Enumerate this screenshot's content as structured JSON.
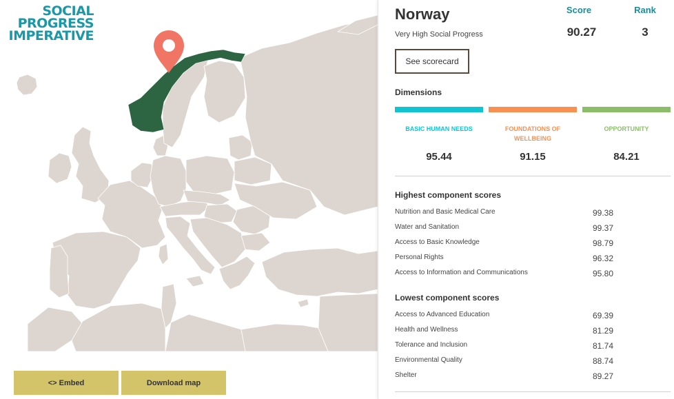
{
  "brand": {
    "logo_lines": [
      "SOCIAL",
      "PROGRESS",
      "IMPERATIVE"
    ],
    "accent_color": "#1a98a8"
  },
  "map": {
    "selected_color": "#2d6442",
    "land_color": "#ddd6d0",
    "marker_color": "#f07565",
    "marker_icon": "location-pin-icon"
  },
  "actions": {
    "embed_label": "<> Embed",
    "download_label": "Download map"
  },
  "panel": {
    "country": "Norway",
    "tier": "Very High Social Progress",
    "score_label": "Score",
    "rank_label": "Rank",
    "score": "90.27",
    "rank": "3",
    "scorecard_label": "See scorecard",
    "dimensions_heading": "Dimensions",
    "dimensions": [
      {
        "label_lines": [
          "BASIC HUMAN NEEDS"
        ],
        "value": "95.44",
        "color": "#11c4d4"
      },
      {
        "label_lines": [
          "FOUNDATIONS OF",
          "WELLBEING"
        ],
        "value": "91.15",
        "color": "#f79051"
      },
      {
        "label_lines": [
          "OPPORTUNITY"
        ],
        "value": "84.21",
        "color": "#8cbe6a"
      }
    ],
    "highest_heading": "Highest component scores",
    "highest": [
      {
        "name": "Nutrition and Basic Medical Care",
        "value": "99.38"
      },
      {
        "name": "Water and Sanitation",
        "value": "99.37"
      },
      {
        "name": "Access to Basic Knowledge",
        "value": "98.79"
      },
      {
        "name": "Personal Rights",
        "value": "96.32"
      },
      {
        "name": "Access to Information and Communications",
        "value": "95.80"
      }
    ],
    "lowest_heading": "Lowest component scores",
    "lowest": [
      {
        "name": "Access to Advanced Education",
        "value": "69.39"
      },
      {
        "name": "Health and Wellness",
        "value": "81.29"
      },
      {
        "name": "Tolerance and Inclusion",
        "value": "81.74"
      },
      {
        "name": "Environmental Quality",
        "value": "88.74"
      },
      {
        "name": "Shelter",
        "value": "89.27"
      }
    ]
  }
}
